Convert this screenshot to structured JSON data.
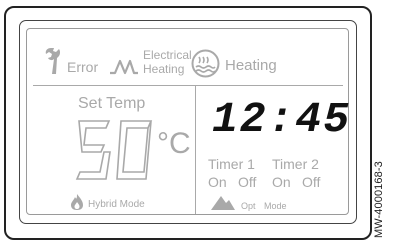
{
  "status_bar": {
    "error_label": "Error",
    "electrical_heating_line1": "Electrical",
    "electrical_heating_line2": "Heating",
    "heating_label": "Heating"
  },
  "temperature_panel": {
    "set_temp_label": "Set Temp",
    "temperature_value": "50",
    "temperature_unit": "°C",
    "hybrid_mode_label": "Hybrid Mode"
  },
  "clock_panel": {
    "time_value": "12:45",
    "timer1_label": "Timer 1",
    "timer2_label": "Timer 2",
    "timer1_on": "On",
    "timer1_off": "Off",
    "timer2_on": "On",
    "timer2_off": "Off",
    "opt_label": "Opt",
    "mode_label": "Mode"
  },
  "reference_code": "MW-4000168-3",
  "colors": {
    "active": "#111111",
    "inactive": "#a9a9a9",
    "frame": "#222222"
  },
  "icons": {
    "error": "wrench-icon",
    "electrical_heating": "zigzag-coil-icon",
    "heating": "heating-circle-icon",
    "hybrid_mode": "flame-icon",
    "opt_mode": "mountain-icon"
  }
}
